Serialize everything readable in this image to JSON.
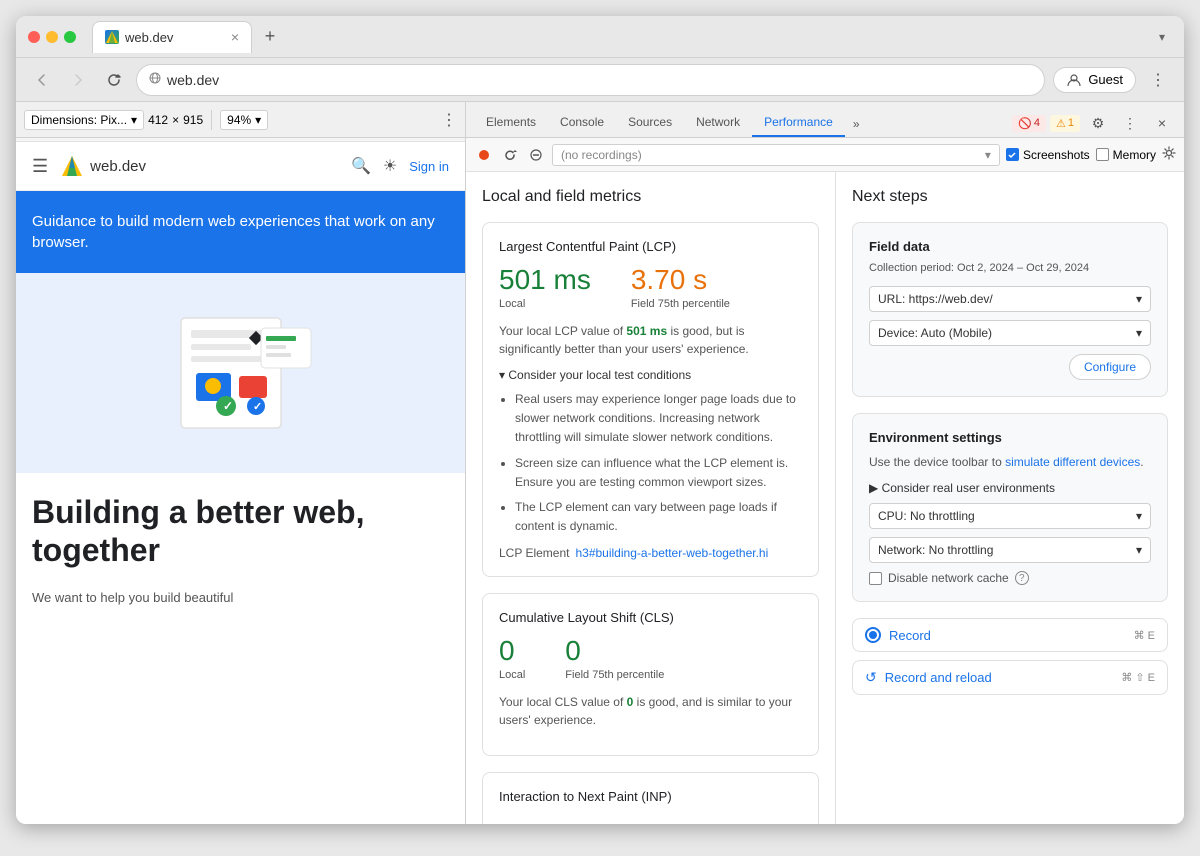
{
  "browser": {
    "tab_title": "web.dev",
    "tab_close": "×",
    "tab_new": "+",
    "url": "web.dev",
    "guest_label": "Guest",
    "chevron": "›"
  },
  "devtools_toolbar": {
    "dimensions_label": "Dimensions: Pix...",
    "width": "412",
    "cross": "×",
    "height": "915",
    "zoom": "94%"
  },
  "devtools_tabs": {
    "items": [
      "Elements",
      "Console",
      "Sources",
      "Network",
      "Performance"
    ],
    "active": "Performance",
    "more": "»"
  },
  "error_badges": {
    "error_count": "4",
    "warning_count": "1"
  },
  "recording_toolbar": {
    "placeholder": "(no recordings)",
    "screenshots_label": "Screenshots",
    "memory_label": "Memory"
  },
  "metrics": {
    "section_title": "Local and field metrics",
    "lcp": {
      "title": "Largest Contentful Paint (LCP)",
      "local_value": "501 ms",
      "field_value": "3.70 s",
      "local_label": "Local",
      "field_label": "Field 75th percentile",
      "desc_text": "Your local LCP value of ",
      "desc_highlight": "501 ms",
      "desc_rest": " is good, but is significantly better than your users' experience.",
      "collapsible": "▾ Consider your local test conditions",
      "bullets": [
        "Real users may experience longer page loads due to slower network conditions. Increasing network throttling will simulate slower network conditions.",
        "Screen size can influence what the LCP element is. Ensure you are testing common viewport sizes.",
        "The LCP element can vary between page loads if content is dynamic."
      ],
      "lcp_element_label": "LCP Element",
      "lcp_link": "h3#building-a-better-web-together.hi"
    },
    "cls": {
      "title": "Cumulative Layout Shift (CLS)",
      "local_value": "0",
      "field_value": "0",
      "local_label": "Local",
      "field_label": "Field 75th percentile",
      "desc_text": "Your local CLS value of ",
      "desc_highlight": "0",
      "desc_rest": " is good, and is similar to your users' experience."
    },
    "inp": {
      "title": "Interaction to Next Paint (INP)"
    }
  },
  "nextsteps": {
    "title": "Next steps",
    "field_data": {
      "title": "Field data",
      "subtitle": "Collection period: Oct 2, 2024 – Oct 29, 2024",
      "url_label": "URL: https://web.dev/",
      "device_label": "Device: Auto (Mobile)",
      "configure_label": "Configure"
    },
    "env_settings": {
      "title": "Environment settings",
      "desc": "Use the device toolbar to ",
      "link_text": "simulate different devices",
      "link_suffix": ".",
      "collapsible": "▶ Consider real user environments",
      "cpu_label": "CPU: No throttling",
      "network_label": "Network: No throttling",
      "cache_label": "Disable network cache"
    },
    "record": {
      "label": "Record",
      "shortcut": "⌘ E"
    },
    "record_reload": {
      "label": "Record and reload",
      "shortcut": "⌘ ⇧ E"
    }
  },
  "site": {
    "logo_text": "web.dev",
    "signin": "Sign in",
    "hero_text": "Guidance to build modern web experiences that work on any browser.",
    "hero_heading": "Building a better web, together",
    "hero_sub": "We want to help you build beautiful"
  },
  "icons": {
    "hamburger": "☰",
    "search": "🔍",
    "theme": "☀",
    "back": "←",
    "forward": "→",
    "reload": "↺",
    "close": "×",
    "more": "⋮",
    "gear": "⚙",
    "dropdown": "▾",
    "record_circle": "⏺",
    "reload_record": "↺"
  }
}
